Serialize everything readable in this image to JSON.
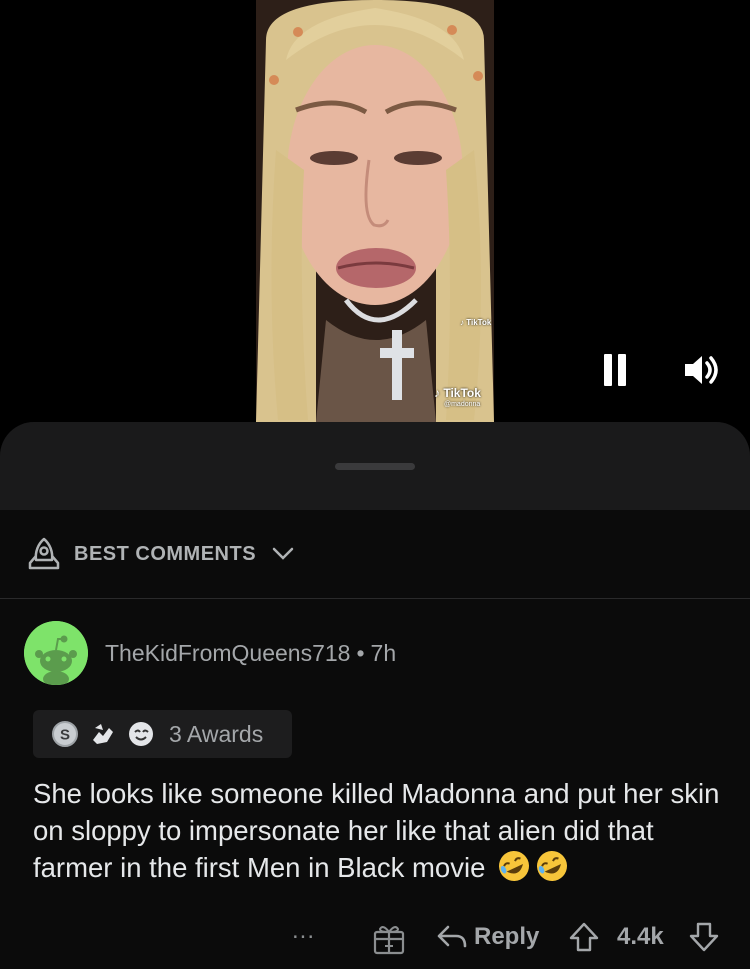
{
  "video": {
    "watermark_brand": "TikTok",
    "watermark_handle": "@madonna",
    "controls": {
      "pause_icon": "pause-icon",
      "volume_icon": "volume-icon"
    }
  },
  "comments_header": {
    "sort_label": "BEST COMMENTS",
    "sort_icon": "rocket-icon"
  },
  "comment": {
    "author": "TheKidFromQueens718",
    "separator": "•",
    "time": "7h",
    "awards_label": "3 Awards",
    "award_icons": [
      "silver-award-icon",
      "helpful-award-icon",
      "wholesome-award-icon"
    ],
    "body": "She looks like someone  killed Madonna and put her skin on sloppy to impersonate her like that alien did that farmer in the first Men in Black movie",
    "emojis": [
      "rofl-emoji",
      "rofl-emoji"
    ],
    "actions": {
      "more": "...",
      "reply": "Reply",
      "score": "4.4k"
    }
  },
  "colors": {
    "background": "#000000",
    "sheet": "#0b0b0b",
    "sheet_top": "#1a1a1b",
    "text_primary": "#e6e8ea",
    "text_secondary": "#a4a7aa",
    "avatar": "#7ee36a"
  }
}
